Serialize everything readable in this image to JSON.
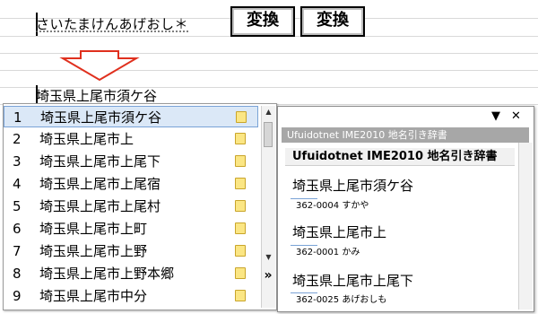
{
  "input": {
    "reading": "さいたまけんあげおし＊"
  },
  "buttons": [
    {
      "label": "変換"
    },
    {
      "label": "変換"
    }
  ],
  "converted": "埼玉県上尾市須ケ谷",
  "candidates": [
    {
      "num": "1",
      "text": "埼玉県上尾市須ケ谷"
    },
    {
      "num": "2",
      "text": "埼玉県上尾市上"
    },
    {
      "num": "3",
      "text": "埼玉県上尾市上尾下"
    },
    {
      "num": "4",
      "text": "埼玉県上尾市上尾宿"
    },
    {
      "num": "5",
      "text": "埼玉県上尾市上尾村"
    },
    {
      "num": "6",
      "text": "埼玉県上尾市上町"
    },
    {
      "num": "7",
      "text": "埼玉県上尾市上野"
    },
    {
      "num": "8",
      "text": "埼玉県上尾市上野本郷"
    },
    {
      "num": "9",
      "text": "埼玉県上尾市中分"
    }
  ],
  "candidate_list": {
    "selected_index": 0,
    "expand_glyph": "»",
    "note_icon": "note-icon"
  },
  "dictionary": {
    "title": "Ufuidotnet IME2010 地名引き辞書",
    "heading": "Ufuidotnet IME2010 地名引き辞書",
    "controls": {
      "menu": "▼",
      "close": "✕"
    },
    "entries": [
      {
        "word": "埼玉県上尾市須ケ谷",
        "detail": "362-0004 すかや"
      },
      {
        "word": "埼玉県上尾市上",
        "detail": "362-0001 かみ"
      },
      {
        "word": "埼玉県上尾市上尾下",
        "detail": "362-0025 あげおしも"
      }
    ]
  },
  "colors": {
    "selection": "#dbe8f7",
    "arrow": "#e0301e",
    "dict_titlebar": "#a7a7a7"
  }
}
